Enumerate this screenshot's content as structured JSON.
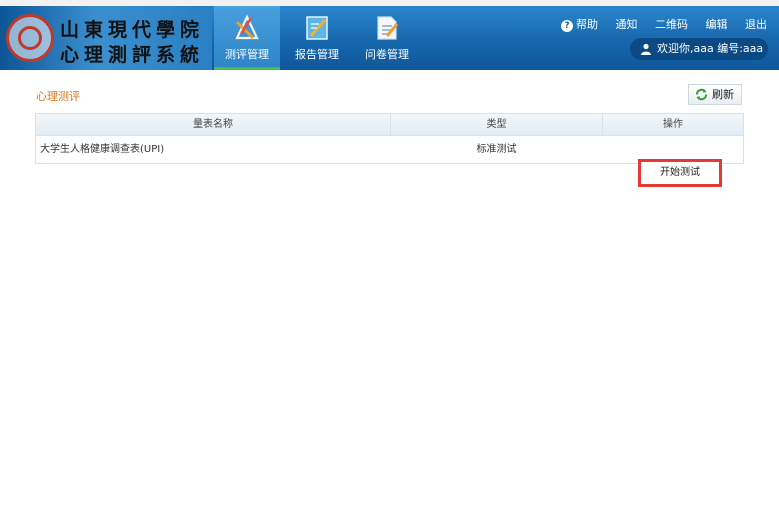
{
  "header": {
    "logo_line1": "山東現代學院",
    "logo_line2": "心理測評系統",
    "nav": [
      {
        "label": "测评管理",
        "icon": "assessment-icon",
        "active": true
      },
      {
        "label": "报告管理",
        "icon": "report-icon",
        "active": false
      },
      {
        "label": "问卷管理",
        "icon": "questionnaire-icon",
        "active": false
      }
    ],
    "links": {
      "help": "帮助",
      "notice": "通知",
      "qrcode": "二维码",
      "edit": "编辑",
      "logout": "退出"
    },
    "user_text": "欢迎你,aaa 编号:aaa"
  },
  "main": {
    "section_title": "心理测评",
    "refresh_label": "刷新",
    "table": {
      "columns": [
        "量表名称",
        "类型",
        "操作"
      ],
      "rows": [
        {
          "name": "大学生人格健康调查表(UPI)",
          "type": "标准测试",
          "action": "开始测试"
        }
      ]
    }
  },
  "colors": {
    "header_blue": "#1767ad",
    "accent_orange": "#d0751e",
    "highlight_red": "#e53935",
    "active_underline": "#48c048"
  }
}
